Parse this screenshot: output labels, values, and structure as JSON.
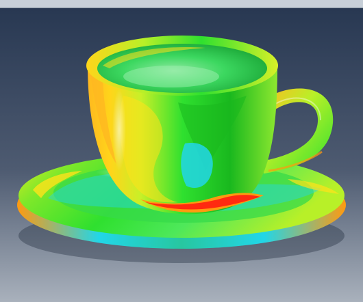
{
  "colors": {
    "top_strip": "#c7cfd8",
    "top_strip_edge": "#8a96a4",
    "background_top": "#283852",
    "background_mid": "#4e5b71",
    "background_bottom": "#a9b1bc",
    "thermal_red": "#ff2a10",
    "thermal_orange": "#ff9a10",
    "thermal_yellow": "#ffe21a",
    "thermal_yellow_green": "#b8f028",
    "thermal_green": "#2fe02f",
    "thermal_deep_green": "#19b81e",
    "thermal_cyan": "#22d6e8",
    "thermal_teal": "#27c7a0"
  },
  "scene": {
    "subject": "thermal-colored-coffee-cup-on-saucer"
  }
}
